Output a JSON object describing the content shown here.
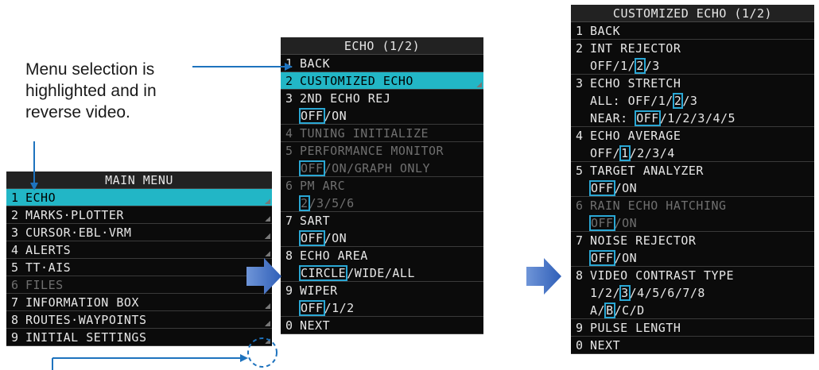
{
  "callout": {
    "lines": [
      "Menu selection is",
      "highlighted and in",
      "reverse video."
    ]
  },
  "main_menu": {
    "title": "MAIN MENU",
    "items": [
      {
        "num": "1",
        "label": "ECHO",
        "state": "selected"
      },
      {
        "num": "2",
        "label": "MARKS·PLOTTER",
        "state": "normal"
      },
      {
        "num": "3",
        "label": "CURSOR·EBL·VRM",
        "state": "normal"
      },
      {
        "num": "4",
        "label": "ALERTS",
        "state": "normal"
      },
      {
        "num": "5",
        "label": "TT·AIS",
        "state": "normal"
      },
      {
        "num": "6",
        "label": "FILES",
        "state": "disabled"
      },
      {
        "num": "7",
        "label": "INFORMATION BOX",
        "state": "normal"
      },
      {
        "num": "8",
        "label": "ROUTES·WAYPOINTS",
        "state": "normal"
      },
      {
        "num": "9",
        "label": "INITIAL SETTINGS",
        "state": "normal"
      }
    ]
  },
  "echo_menu": {
    "title": "ECHO (1/2)",
    "items": [
      {
        "num": "1",
        "label": "BACK"
      },
      {
        "num": "2",
        "label": "CUSTOMIZED ECHO",
        "state": "selected"
      },
      {
        "num": "3",
        "label": "2ND ECHO REJ",
        "options": [
          {
            "t": "OFF",
            "sel": true
          },
          {
            "t": "/ON"
          }
        ]
      },
      {
        "num": "4",
        "label": "TUNING INITIALIZE",
        "state": "disabled"
      },
      {
        "num": "5",
        "label": "PERFORMANCE MONITOR",
        "state": "disabled",
        "options": [
          {
            "t": "OFF",
            "sel": true
          },
          {
            "t": "/ON/GRAPH ONLY"
          }
        ]
      },
      {
        "num": "6",
        "label": "PM ARC",
        "state": "disabled",
        "options": [
          {
            "t": "2",
            "sel": true
          },
          {
            "t": "/3/5/6"
          }
        ]
      },
      {
        "num": "7",
        "label": "SART",
        "options": [
          {
            "t": "OFF",
            "sel": true
          },
          {
            "t": "/ON"
          }
        ]
      },
      {
        "num": "8",
        "label": "ECHO AREA",
        "options": [
          {
            "t": "CIRCLE",
            "sel": true
          },
          {
            "t": "/WIDE/ALL"
          }
        ]
      },
      {
        "num": "9",
        "label": "WIPER",
        "options": [
          {
            "t": "OFF",
            "sel": true
          },
          {
            "t": "/1/2"
          }
        ]
      },
      {
        "num": "0",
        "label": "NEXT"
      }
    ]
  },
  "custom_menu": {
    "title": "CUSTOMIZED ECHO (1/2)",
    "items": [
      {
        "num": "1",
        "label": "BACK"
      },
      {
        "num": "2",
        "label": "INT REJECTOR",
        "optrows": [
          [
            {
              "t": "OFF/1/"
            },
            {
              "t": "2",
              "sel": true
            },
            {
              "t": "/3"
            }
          ]
        ]
      },
      {
        "num": "3",
        "label": "ECHO STRETCH",
        "optrows": [
          [
            {
              "t": "ALL:   OFF/1/"
            },
            {
              "t": "2",
              "sel": true
            },
            {
              "t": "/3"
            }
          ],
          [
            {
              "t": "NEAR:  "
            },
            {
              "t": "OFF",
              "sel": true
            },
            {
              "t": "/1/2/3/4/5"
            }
          ]
        ]
      },
      {
        "num": "4",
        "label": "ECHO AVERAGE",
        "optrows": [
          [
            {
              "t": "OFF/"
            },
            {
              "t": "1",
              "sel": true
            },
            {
              "t": "/2/3/4"
            }
          ]
        ]
      },
      {
        "num": "5",
        "label": "TARGET ANALYZER",
        "optrows": [
          [
            {
              "t": "OFF",
              "sel": true
            },
            {
              "t": "/ON"
            }
          ]
        ]
      },
      {
        "num": "6",
        "label": "RAIN ECHO HATCHING",
        "state": "disabled",
        "optrows": [
          [
            {
              "t": "OFF",
              "sel": true
            },
            {
              "t": "/ON"
            }
          ]
        ]
      },
      {
        "num": "7",
        "label": "NOISE REJECTOR",
        "optrows": [
          [
            {
              "t": "OFF",
              "sel": true
            },
            {
              "t": "/ON"
            }
          ]
        ]
      },
      {
        "num": "8",
        "label": "VIDEO CONTRAST TYPE",
        "optrows": [
          [
            {
              "t": "1/2/"
            },
            {
              "t": "3",
              "sel": true
            },
            {
              "t": "/4/5/6/7/8"
            }
          ],
          [
            {
              "t": "A/"
            },
            {
              "t": "B",
              "sel": true
            },
            {
              "t": "/C/D"
            }
          ]
        ]
      },
      {
        "num": "9",
        "label": "PULSE LENGTH"
      },
      {
        "num": "0",
        "label": "NEXT"
      }
    ]
  },
  "colors": {
    "highlight": "#22b6c6",
    "option_box": "#2aa7d4",
    "arrow": "#3f6fc6",
    "pointer": "#1e73be"
  }
}
